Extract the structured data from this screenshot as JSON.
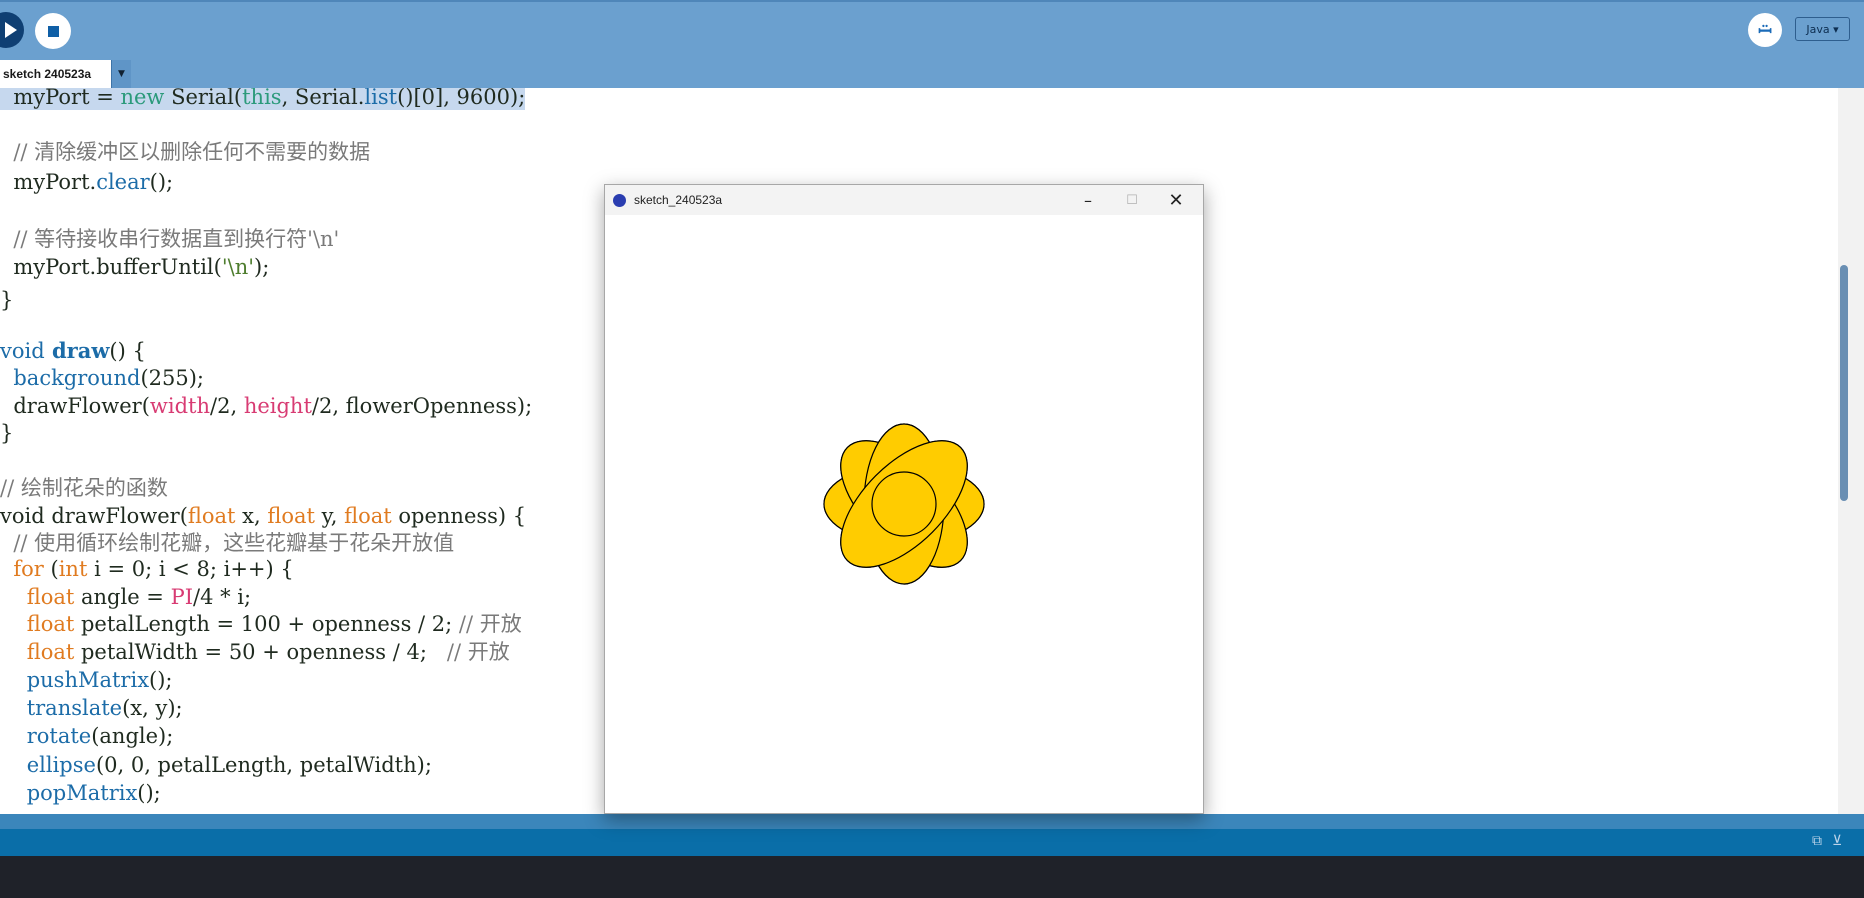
{
  "toolbar": {
    "run_label": "Run",
    "stop_label": "Stop",
    "debug_icon": "debugger-icon",
    "mode": "Java ▾"
  },
  "tabs": [
    {
      "label": "sketch 240523a"
    }
  ],
  "code": {
    "lines": [
      [
        "  myPort = ",
        "new",
        " Serial(",
        "this",
        ", Serial.",
        "list",
        "()[0], 9600);"
      ],
      "  // 清除缓冲区以删除任何不需要的数据",
      [
        "  myPort.",
        "clear",
        "();"
      ],
      "  // 等待接收串行数据直到换行符'\\n'",
      [
        "  myPort.bufferUntil(",
        "'\\n'",
        ");"
      ],
      "}",
      [
        "void",
        " draw",
        "() {"
      ],
      [
        "  ",
        "background",
        "(255);"
      ],
      [
        "  drawFlower(",
        "width",
        "/2, ",
        "height",
        "/2, flowerOpenness);"
      ],
      "}",
      "// 绘制花朵的函数",
      [
        "void drawFlower(",
        "float",
        " x, ",
        "float",
        " y, ",
        "float",
        " openness) {"
      ],
      "  // 使用循环绘制花瓣，这些花瓣基于花朵开放值",
      [
        "  ",
        "for",
        " (",
        "int",
        " i = 0; i < 8; i++) {"
      ],
      [
        "    ",
        "float",
        " angle = ",
        "PI",
        "/4 * i;"
      ],
      [
        "    ",
        "float",
        " petalLength = 100 + openness / 2; ",
        "// 开放"
      ],
      [
        "    ",
        "float",
        " petalWidth = 50 + openness / 4;   ",
        "// 开放"
      ],
      [
        "    ",
        "pushMatrix",
        "();"
      ],
      [
        "    ",
        "translate",
        "(x, y);"
      ],
      [
        "    ",
        "rotate",
        "(angle);"
      ],
      [
        "    ",
        "ellipse",
        "(0, 0, petalLength, petalWidth);"
      ],
      [
        "    ",
        "popMatrix",
        "();"
      ]
    ]
  },
  "sketch_window": {
    "title": "sketch_240523a",
    "minimize": "–",
    "maximize": "☐",
    "close": "✕",
    "flower_color": "#FFCC00",
    "petal_count": 8
  },
  "console": {
    "copy_icon": "copy-icon",
    "filter_icon": "filter-icon"
  }
}
